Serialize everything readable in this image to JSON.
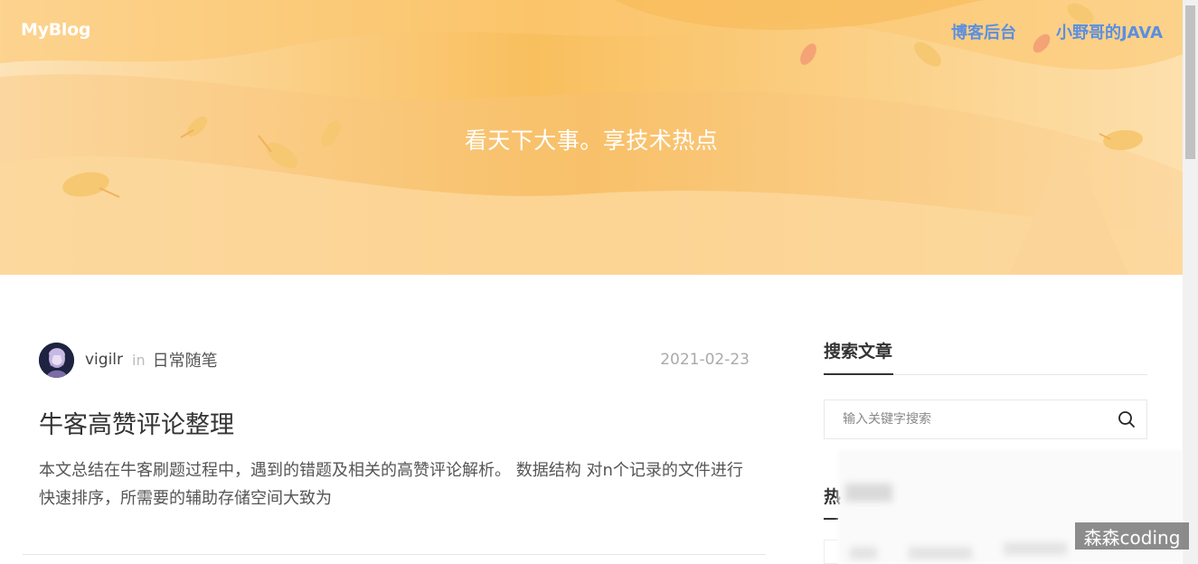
{
  "header": {
    "brand": "MyBlog",
    "nav": [
      "博客后台",
      "小野哥的JAVA"
    ],
    "tagline": "看天下大事。享技术热点"
  },
  "post": {
    "author": "vigilr",
    "in_label": "in",
    "category": "日常随笔",
    "date": "2021-02-23",
    "title": "牛客高赞评论整理",
    "excerpt": "本文总结在牛客刷题过程中，遇到的错题及相关的高赞评论解析。 数据结构 对n个记录的文件进行快速排序，所需要的辅助存储空间大致为"
  },
  "sidebar": {
    "search_title": "搜索文章",
    "search_placeholder": "输入关键字搜索",
    "hot_title_partial": "热"
  },
  "watermark": "森森coding",
  "colors": {
    "hero_bg": "#fbd18a",
    "nav_link": "#5b8fe0",
    "tagline": "#ffffff"
  },
  "icons": {
    "search": "search-icon",
    "avatar": "avatar"
  }
}
